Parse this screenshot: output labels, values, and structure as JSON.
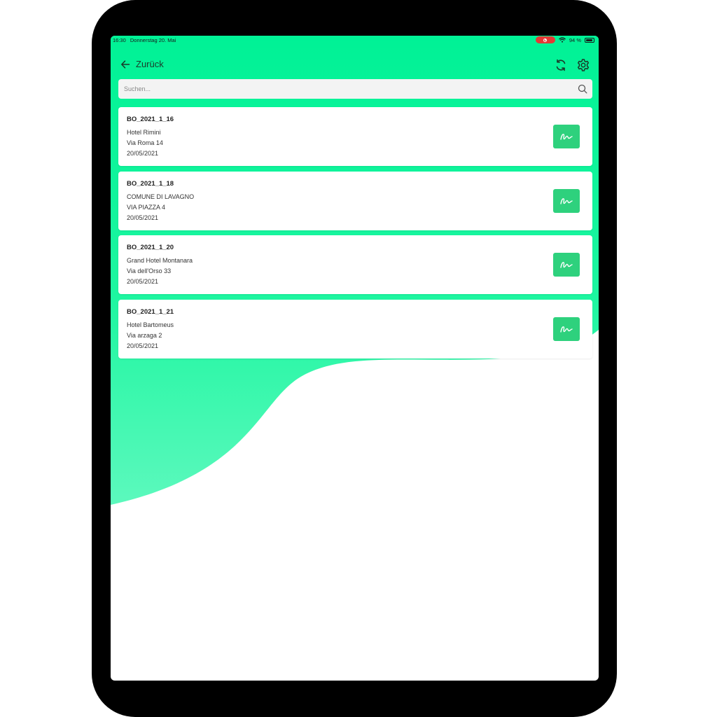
{
  "status_bar": {
    "time": "16:30",
    "date": "Donnerstag 20. Mai",
    "battery": "94 %"
  },
  "nav": {
    "back_label": "Zurück"
  },
  "search": {
    "placeholder": "Suchen..."
  },
  "colors": {
    "accent": "#00f296",
    "sign_button": "#2ed17d",
    "record_indicator": "#e53935"
  },
  "icons": {
    "back": "arrow-left-icon",
    "sync": "sync-icon",
    "settings": "gear-icon",
    "search": "search-icon",
    "sign": "signature-icon"
  },
  "items": [
    {
      "id": "BO_2021_1_16",
      "name": "Hotel Rimini",
      "address": "Via Roma 14",
      "date": "20/05/2021"
    },
    {
      "id": "BO_2021_1_18",
      "name": "COMUNE DI LAVAGNO",
      "address": "VIA PIAZZA 4",
      "date": "20/05/2021"
    },
    {
      "id": "BO_2021_1_20",
      "name": "Grand Hotel Montanara",
      "address": "Via dell'Orso 33",
      "date": "20/05/2021"
    },
    {
      "id": "BO_2021_1_21",
      "name": "Hotel Bartomeus",
      "address": "Via arzaga 2",
      "date": "20/05/2021"
    }
  ]
}
